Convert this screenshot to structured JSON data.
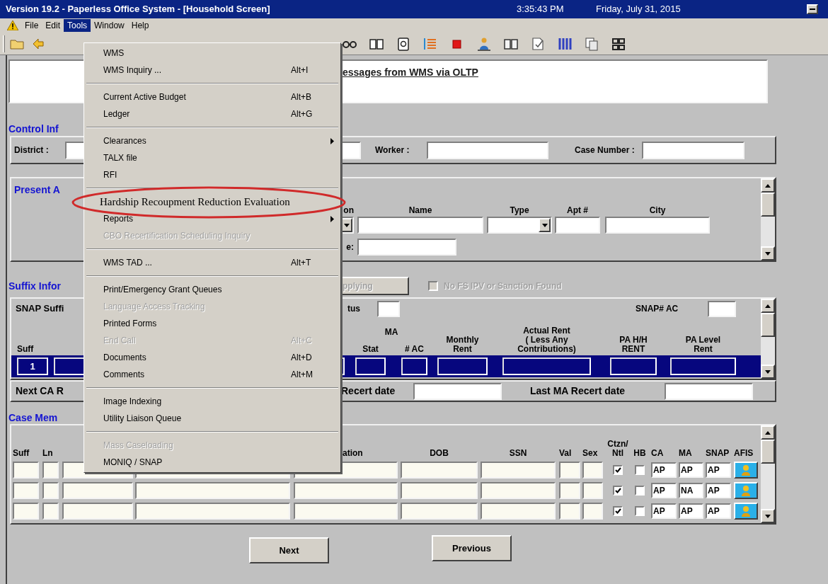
{
  "window": {
    "title": "Version 19.2 - Paperless Office System - [Household Screen]",
    "time": "3:35:43 PM",
    "date": "Friday, July 31, 2015"
  },
  "menu_bar": [
    {
      "label": "File",
      "selected": false
    },
    {
      "label": "Edit",
      "selected": false
    },
    {
      "label": "Tools",
      "selected": true
    },
    {
      "label": "Window",
      "selected": false
    },
    {
      "label": "Help",
      "selected": false
    }
  ],
  "tools_menu": {
    "items": [
      {
        "kind": "item",
        "label": "WMS",
        "disabled": false,
        "submenu": false,
        "annotated": false
      },
      {
        "kind": "item",
        "label": "WMS Inquiry ...",
        "shortcut": "Alt+I",
        "disabled": false,
        "submenu": false,
        "annotated": false
      },
      {
        "kind": "separator"
      },
      {
        "kind": "item",
        "label": "Current Active Budget",
        "shortcut": "Alt+B",
        "disabled": false,
        "submenu": false,
        "annotated": false
      },
      {
        "kind": "item",
        "label": "Ledger",
        "shortcut": "Alt+G",
        "disabled": false,
        "submenu": false,
        "annotated": false
      },
      {
        "kind": "separator"
      },
      {
        "kind": "item",
        "label": "Clearances",
        "disabled": false,
        "submenu": true,
        "annotated": false
      },
      {
        "kind": "item",
        "label": "TALX file",
        "disabled": false,
        "submenu": false,
        "annotated": false
      },
      {
        "kind": "item",
        "label": "RFI",
        "disabled": false,
        "submenu": false,
        "annotated": false
      },
      {
        "kind": "separator"
      },
      {
        "kind": "item",
        "label": "Hardship Recoupment Reduction Evaluation",
        "disabled": false,
        "submenu": false,
        "annotated": true
      },
      {
        "kind": "item",
        "label": "Reports",
        "disabled": false,
        "submenu": true,
        "annotated": false
      },
      {
        "kind": "item",
        "label": "CBO Recertification Scheduling Inquiry",
        "disabled": true,
        "submenu": false,
        "annotated": false
      },
      {
        "kind": "separator"
      },
      {
        "kind": "item",
        "label": "WMS TAD ...",
        "shortcut": "Alt+T",
        "disabled": false,
        "submenu": false,
        "annotated": false
      },
      {
        "kind": "separator"
      },
      {
        "kind": "item",
        "label": "Print/Emergency Grant Queues",
        "disabled": false,
        "submenu": false,
        "annotated": false
      },
      {
        "kind": "item",
        "label": "Language Access Tracking",
        "disabled": true,
        "submenu": false,
        "annotated": false
      },
      {
        "kind": "item",
        "label": "Printed Forms",
        "disabled": false,
        "submenu": false,
        "annotated": false
      },
      {
        "kind": "item",
        "label": "End Call",
        "shortcut": "Alt+C",
        "disabled": true,
        "submenu": false,
        "annotated": false
      },
      {
        "kind": "item",
        "label": "Documents",
        "shortcut": "Alt+D",
        "disabled": false,
        "submenu": false,
        "annotated": false
      },
      {
        "kind": "item",
        "label": "Comments",
        "shortcut": "Alt+M",
        "disabled": false,
        "submenu": false,
        "annotated": false
      },
      {
        "kind": "separator"
      },
      {
        "kind": "item",
        "label": "Image Indexing",
        "disabled": false,
        "submenu": false,
        "annotated": false
      },
      {
        "kind": "item",
        "label": "Utility Liaison Queue",
        "disabled": false,
        "submenu": false,
        "annotated": false
      },
      {
        "kind": "separator"
      },
      {
        "kind": "item",
        "label": "Mass Caseloading",
        "disabled": true,
        "submenu": false,
        "annotated": false
      },
      {
        "kind": "item",
        "label": "MONIQ / SNAP",
        "disabled": false,
        "submenu": false,
        "annotated": false
      }
    ]
  },
  "message_panel": {
    "text": "essages from WMS via OLTP"
  },
  "control_info": {
    "heading": "Control Inf",
    "district_label": "District :",
    "worker_label": "Worker :",
    "case_number_label": "Case Number :"
  },
  "present_address": {
    "heading": "Present A",
    "columns": [
      "on",
      "Name",
      "Type",
      "Apt #",
      "City"
    ],
    "second_label": "e:"
  },
  "suffix_info": {
    "heading": "Suffix Infor",
    "applying_button": {
      "label": "pplying",
      "disabled": true
    },
    "sanction_checkbox": {
      "label": "No FS IPV or Sanction Found",
      "checked": false,
      "disabled": true
    },
    "snap_suffix_label": "SNAP Suffi",
    "status_label": "tus",
    "snap_ac_label": "SNAP# AC",
    "columns": [
      "Suff",
      "MA",
      "Stat",
      "# AC",
      "Monthly\nRent",
      "Actual Rent\n( Less Any\nContributions)",
      "PA H/H\nRENT",
      "PA Level\nRent"
    ],
    "rows": [
      {
        "suff": "1",
        "selected": true
      }
    ]
  },
  "recert": {
    "next_ca_label": "Next CA R",
    "recert_label": "Recert date",
    "last_ma_label": "Last MA Recert date"
  },
  "case_members": {
    "heading": "Case Mem",
    "columns": [
      "Suff",
      "Ln",
      "ation",
      "DOB",
      "SSN",
      "Val",
      "Sex",
      "Ctzn/\nNtl",
      "HB",
      "CA",
      "MA",
      "SNAP",
      "AFIS"
    ],
    "rows": [
      {
        "ntl": true,
        "hb": false,
        "ca": "AP",
        "ma": "AP",
        "snap": "AP"
      },
      {
        "ntl": true,
        "hb": false,
        "ca": "AP",
        "ma": "NA",
        "snap": "AP"
      },
      {
        "ntl": true,
        "hb": false,
        "ca": "AP",
        "ma": "AP",
        "snap": "AP"
      }
    ]
  },
  "buttons": [
    {
      "label": "Next"
    },
    {
      "label": "Previous"
    }
  ]
}
